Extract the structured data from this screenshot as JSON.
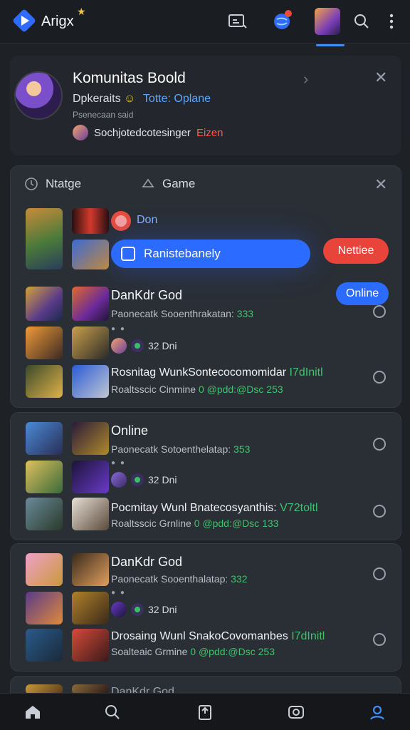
{
  "app": {
    "title": "Arigx"
  },
  "profile": {
    "name": "Komunitas Boold",
    "sub": "Dpkeraits",
    "sub_accent": "Totte: Oplane",
    "small": "Psenecaan said",
    "line": "Sochjotedcotesinger",
    "line_red": "Eizen"
  },
  "tabs": {
    "tab1": "Ntatge",
    "tab2": "Game"
  },
  "section1": {
    "user_label": "Don",
    "blue_button": "Ranistebanely",
    "red_button": "Nettiee",
    "online_pill": "Online",
    "item1_title": "DanKdr God",
    "item1_sub": "Paonecatk Sooenthrakatan:",
    "item1_num": "333",
    "item1_metric": "32 Dni",
    "item2_title": "Rosnitag WunkSontecocomomidar",
    "item2_title_green": "I7dInitl",
    "item2_sub": "Roaltsscic Cinmine",
    "item2_sub_green": "0 @pdd:@Dsc 253"
  },
  "section2": {
    "item1_title": "Online",
    "item1_sub": "Paonecatk Sotoenthelatap:",
    "item1_num": "353",
    "item1_metric": "32 Dni",
    "item2_title": "Pocmitay Wunl Bnatecosyanthis:",
    "item2_title_green": "V72toltl",
    "item2_sub": "Roaltsscic Grnline",
    "item2_sub_green": "0 @pdd:@Dsc 133"
  },
  "section3": {
    "item1_title": "DanKdr God",
    "item1_sub": "Paonecatk Sooenthalatap:",
    "item1_num": "332",
    "item1_metric": "32 Dni",
    "item2_title": "Drosaing Wunl SnakoCovomanbes",
    "item2_title_green": "I7dInitl",
    "item2_sub": "Soalteaic Grmine",
    "item2_sub_green": "0 @pdd:@Dsc 253"
  },
  "section4": {
    "partial_title": "DanKdr God"
  },
  "icons": {
    "top": [
      "video-icon",
      "notification-globe-icon",
      "profile-thumb",
      "search-icon",
      "more-icon"
    ],
    "bottom": [
      "home-icon",
      "search-icon",
      "upload-icon",
      "game-icon",
      "profile-icon"
    ]
  },
  "colors": {
    "accent": "#2c6bff",
    "danger": "#e8443a",
    "success": "#3fc36a",
    "active_nav": "#3e8ef7"
  }
}
